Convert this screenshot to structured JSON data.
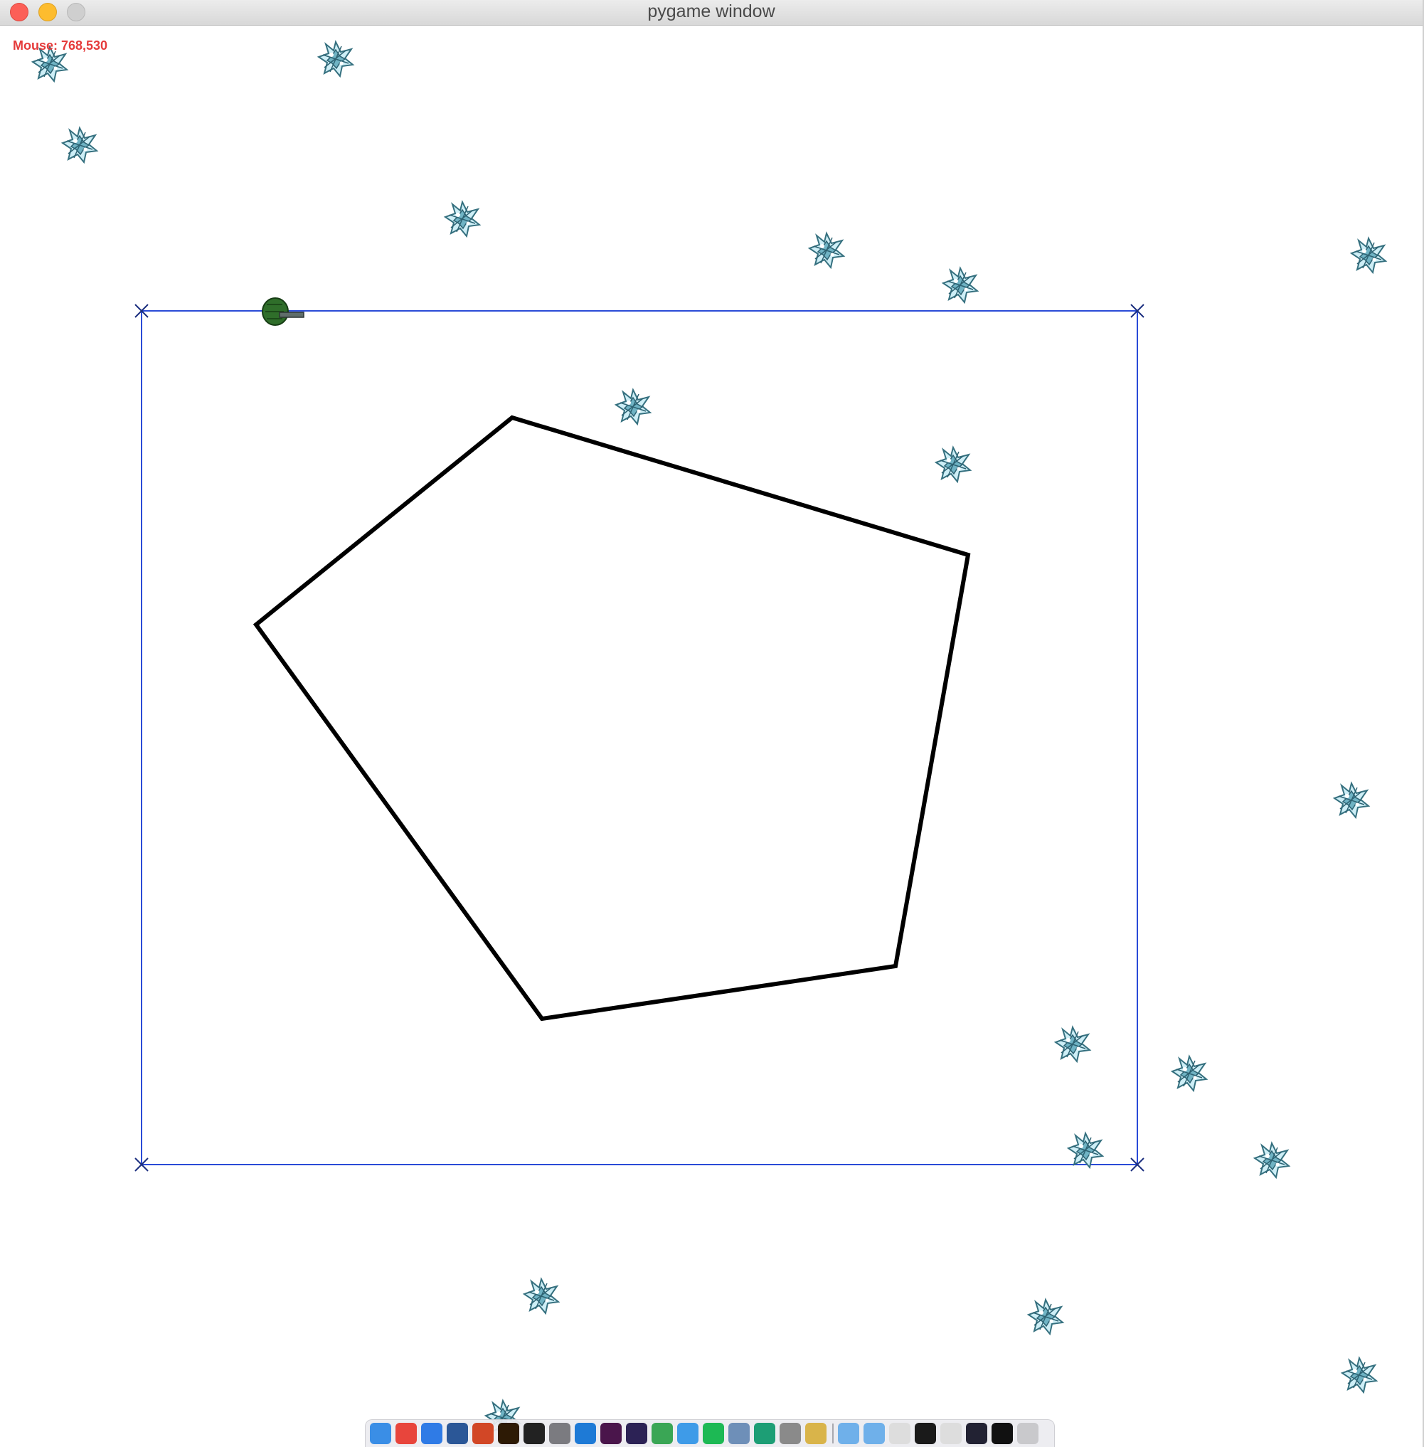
{
  "window": {
    "title": "pygame window"
  },
  "hud": {
    "mouse_readout": "Mouse: 768,530"
  },
  "colors": {
    "background": "#ffffff",
    "boundary": "#2a4bd7",
    "polygon": "#000000",
    "hud_text": "#e53b3b",
    "ice_light": "#bfe6f0",
    "ice_dark": "#3d7f94",
    "player": "#2f6e2a"
  },
  "sprites": {
    "ice_icon": "snowflake-crystal-icon",
    "player_icon": "green-tank-icon"
  },
  "dock": {
    "apps": [
      {
        "name": "finder-icon",
        "color": "#3a8ee6"
      },
      {
        "name": "chrome-icon",
        "color": "#e8453c"
      },
      {
        "name": "safari-icon",
        "color": "#2f7be6"
      },
      {
        "name": "word-icon",
        "color": "#2b5797"
      },
      {
        "name": "powerpoint-icon",
        "color": "#d24726"
      },
      {
        "name": "illustrator-icon",
        "color": "#2d1a05"
      },
      {
        "name": "terminal-icon",
        "color": "#222222"
      },
      {
        "name": "system-preferences-icon",
        "color": "#7b7b80"
      },
      {
        "name": "vscode-icon",
        "color": "#1e7ad6"
      },
      {
        "name": "slack-icon",
        "color": "#4a154b"
      },
      {
        "name": "eclipse-icon",
        "color": "#2c2255"
      },
      {
        "name": "sourcetree-icon",
        "color": "#3aa655"
      },
      {
        "name": "messenger-icon",
        "color": "#3e9be8"
      },
      {
        "name": "spotify-icon",
        "color": "#1db954"
      },
      {
        "name": "preview-icon",
        "color": "#6e8fb8"
      },
      {
        "name": "vscode-insiders-icon",
        "color": "#1d9e75"
      },
      {
        "name": "utility-icon",
        "color": "#8a8a8a"
      },
      {
        "name": "cyberduck-icon",
        "color": "#d9b44a"
      },
      {
        "name": "applications-folder-icon",
        "color": "#6fb0ea"
      },
      {
        "name": "documents-folder-icon",
        "color": "#6fb0ea"
      },
      {
        "name": "window-thumbnail-icon",
        "color": "#dddddd"
      },
      {
        "name": "window-thumbnail-icon",
        "color": "#1a1a1a"
      },
      {
        "name": "window-thumbnail-icon",
        "color": "#dddddd"
      },
      {
        "name": "window-thumbnail-icon",
        "color": "#222233"
      },
      {
        "name": "window-thumbnail-icon",
        "color": "#111111"
      },
      {
        "name": "trash-icon",
        "color": "#c9c9cc"
      }
    ]
  }
}
